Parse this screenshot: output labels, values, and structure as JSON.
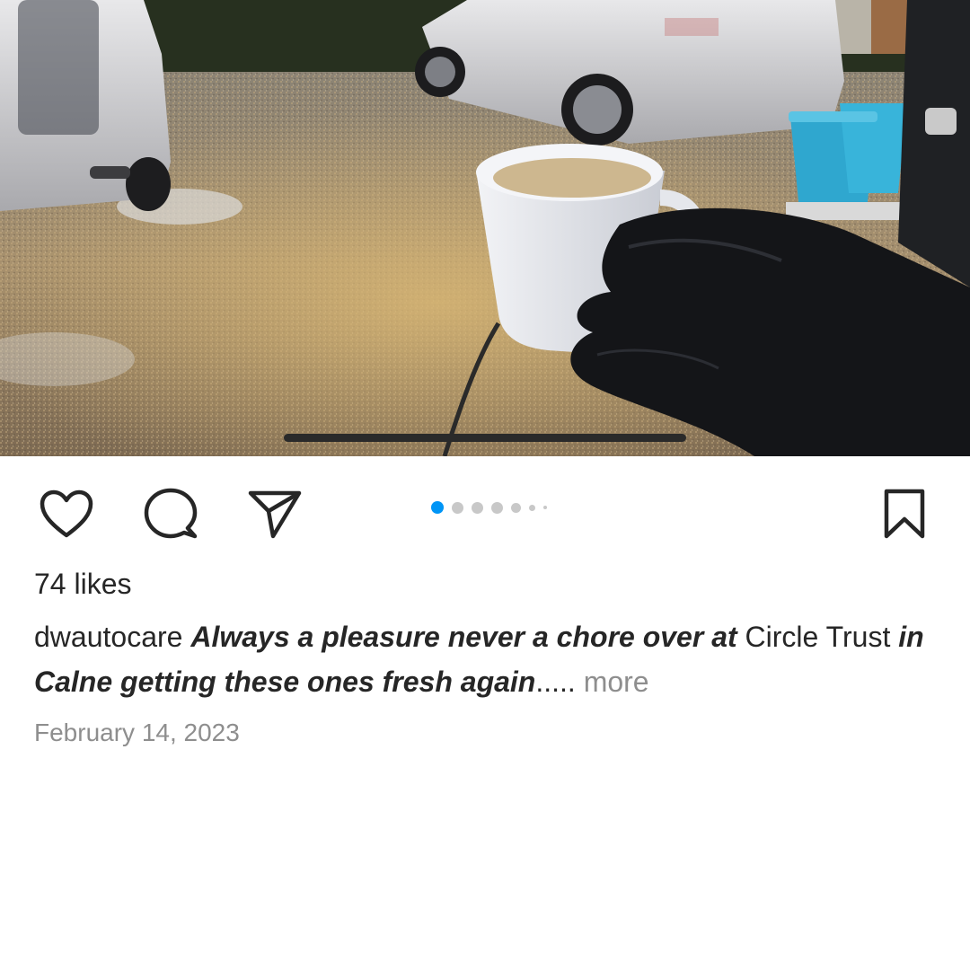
{
  "post": {
    "likes_text": "74 likes",
    "username": "dwautocare",
    "caption": {
      "part1": "Always a pleasure never a chore over at",
      "part2": " Circle Trust ",
      "part3": "in Calne getting these ones fresh again",
      "ellipsis": ".....",
      "more_label": " more"
    },
    "date": "February 14, 2023"
  },
  "carousel": {
    "total_dots": 7,
    "active_index": 0
  },
  "icons": {
    "like": "heart-icon",
    "comment": "comment-bubble-icon",
    "share": "paper-plane-icon",
    "save": "bookmark-icon"
  },
  "colors": {
    "active_dot": "#0095f6",
    "inactive_dot": "#c8c8c8",
    "text": "#262626",
    "muted": "#8e8e8e"
  }
}
